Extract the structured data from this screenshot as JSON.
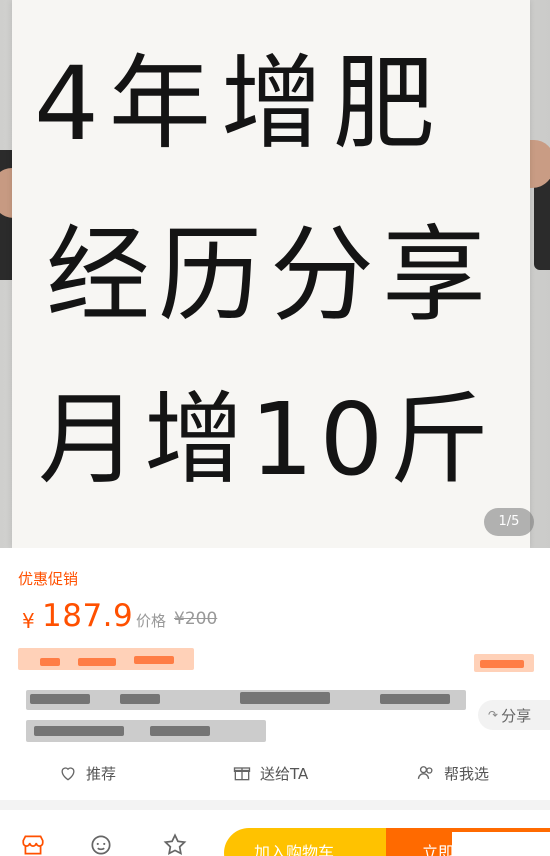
{
  "hero": {
    "sign_lines": [
      "4年增肥",
      "经历分享",
      "月增10斤"
    ],
    "image_counter": "1/5"
  },
  "promo": {
    "tag": "优惠促销",
    "currency": "¥",
    "price": "187.9",
    "old_label": "价格",
    "old_price": "¥200"
  },
  "share": {
    "label": "分享",
    "icon": "share-icon"
  },
  "actions": {
    "recommend": {
      "label": "推荐",
      "icon": "heart-icon"
    },
    "gift": {
      "label": "送给TA",
      "icon": "gift-icon"
    },
    "help_choose": {
      "label": "帮我选",
      "icon": "people-icon"
    }
  },
  "bottom_bar": {
    "store_icon": "store-icon",
    "service_icon": "service-icon",
    "favorite_icon": "star-icon",
    "add_to_cart": "加入购物车",
    "buy_now": "立即购买"
  },
  "colors": {
    "accent": "#ff5000",
    "cart_button": "#ffc200",
    "buy_button": "#ff6a00"
  }
}
